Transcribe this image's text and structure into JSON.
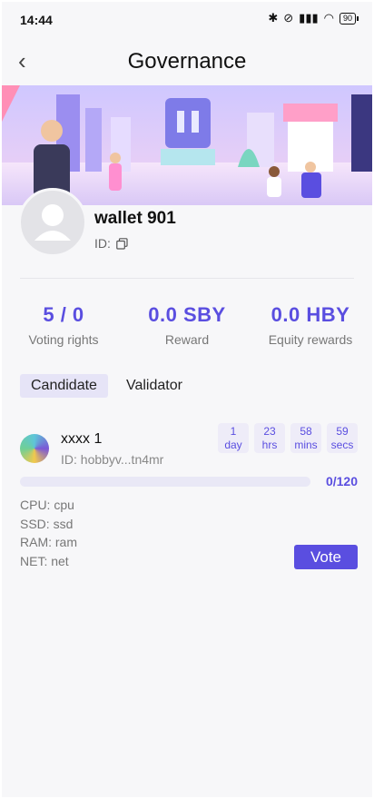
{
  "status_bar": {
    "time": "14:44",
    "battery": "90"
  },
  "header": {
    "title": "Governance"
  },
  "profile": {
    "name": "wallet 901",
    "id_label": "ID:"
  },
  "stats": [
    {
      "value": "5 / 0",
      "label": "Voting rights"
    },
    {
      "value": "0.0  SBY",
      "label": "Reward"
    },
    {
      "value": "0.0  HBY",
      "label": "Equity rewards"
    }
  ],
  "tabs": [
    {
      "label": "Candidate",
      "active": true
    },
    {
      "label": "Validator",
      "active": false
    }
  ],
  "candidate": {
    "name": "xxxx 1",
    "id": "ID: hobbyv...tn4mr",
    "countdown": [
      {
        "value": "1",
        "unit": "day"
      },
      {
        "value": "23",
        "unit": "hrs"
      },
      {
        "value": "58",
        "unit": "mins"
      },
      {
        "value": "59",
        "unit": "secs"
      }
    ],
    "votes": "0/120",
    "progress_fraction": 0,
    "cpu": "CPU: cpu",
    "ssd": "SSD: ssd",
    "ram": "RAM: ram",
    "net": "NET: net",
    "vote_label": "Vote"
  },
  "colors": {
    "accent": "#5a4ee0",
    "accent_light": "#e6e4f7",
    "background": "#f7f7f9"
  }
}
